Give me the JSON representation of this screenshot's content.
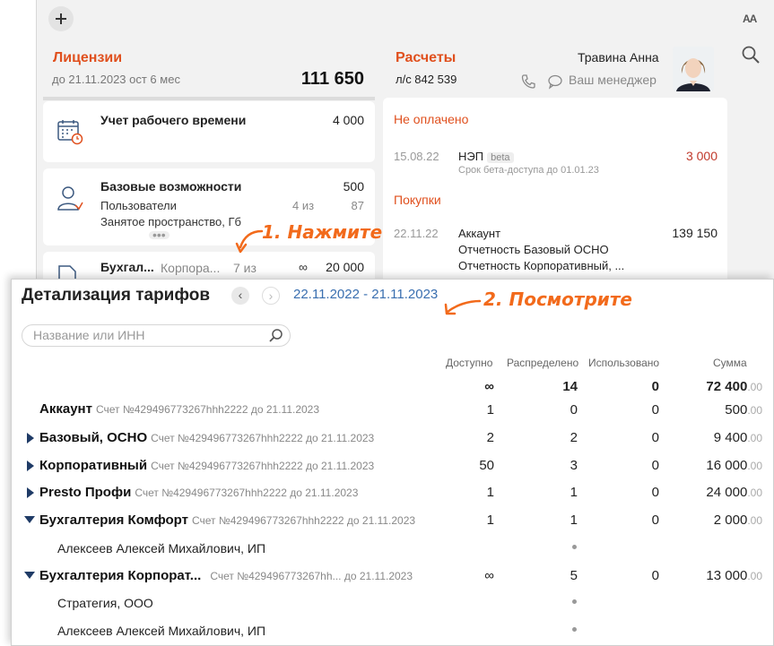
{
  "app": {
    "aa_label": "AA",
    "licenses": {
      "title": "Лицензии",
      "subtitle": "до 21.11.2023 ост 6 мес",
      "total": "111 650",
      "cards": [
        {
          "title": "Учет рабочего времени",
          "amount": "4 000"
        },
        {
          "title": "Базовые возможности",
          "amount": "500",
          "rows": [
            {
              "label": "Пользователи",
              "used": "4 из",
              "total": "87"
            },
            {
              "label": "Занятое пространство, Гб"
            }
          ],
          "more": "•••"
        },
        {
          "title": "Бухгал...",
          "extra": "Корпора...",
          "used": "7 из",
          "infinity": "∞",
          "amount": "20 000"
        }
      ]
    },
    "payments": {
      "title": "Расчеты",
      "account": "л/с 842 539",
      "manager_name": "Травина Анна",
      "manager_link": "Ваш менеджер",
      "unpaid_title": "Не оплачено",
      "unpaid": {
        "date": "15.08.22",
        "name": "НЭП",
        "badge": "beta",
        "note": "Срок бета-доступа до 01.01.23",
        "amount": "3 000"
      },
      "purchases_title": "Покупки",
      "purchase": {
        "date": "22.11.22",
        "lines": [
          "Аккаунт",
          "Отчетность Базовый ОСНО",
          "Отчетность Корпоративный, ..."
        ],
        "amount": "139 150"
      }
    }
  },
  "annotations": {
    "step1": "1. Нажмите",
    "step2": "2. Посмотрите"
  },
  "detail": {
    "title": "Детализация тарифов",
    "prev": "‹",
    "next": "›",
    "period": "22.11.2022 - 21.11.2023",
    "search_placeholder": "Название или ИНН",
    "columns": {
      "available": "Доступно",
      "distributed": "Распределено",
      "used": "Использовано",
      "sum": "Сумма"
    },
    "totals": {
      "available": "∞",
      "distributed": "14",
      "used": "0",
      "sum": "72 400",
      "cents": ".00"
    },
    "rows": [
      {
        "name": "Аккаунт",
        "meta": "Счет №429496773267hhh2222 до 21.11.2023",
        "available": "1",
        "distributed": "0",
        "used": "0",
        "sum": "500",
        "cents": ".00"
      },
      {
        "name": "Базовый, ОСНО",
        "meta": "Счет №429496773267hhh2222 до 21.11.2023",
        "available": "2",
        "distributed": "2",
        "used": "0",
        "sum": "9 400",
        "cents": ".00"
      },
      {
        "name": "Корпоративный",
        "meta": "Счет №429496773267hhh2222 до 21.11.2023",
        "available": "50",
        "distributed": "3",
        "used": "0",
        "sum": "16 000",
        "cents": ".00"
      },
      {
        "name": "Presto Профи",
        "meta": "Счет №429496773267hhh2222 до 21.11.2023",
        "available": "1",
        "distributed": "1",
        "used": "0",
        "sum": "24 000",
        "cents": ".00"
      },
      {
        "name": "Бухгалтерия Комфорт",
        "meta": "Счет №429496773267hhh2222 до 21.11.2023",
        "available": "1",
        "distributed": "1",
        "used": "0",
        "sum": "2 000",
        "cents": ".00",
        "children": [
          "Алексеев Алексей Михайлович, ИП"
        ]
      },
      {
        "name": "Бухгалтерия Корпорат...",
        "meta": "Счет №429496773267hh...  до 21.11.2023",
        "available": "∞",
        "distributed": "5",
        "used": "0",
        "sum": "13 000",
        "cents": ".00",
        "children": [
          "Стратегия, ООО",
          "Алексеев Алексей Михайлович, ИП"
        ]
      }
    ]
  }
}
